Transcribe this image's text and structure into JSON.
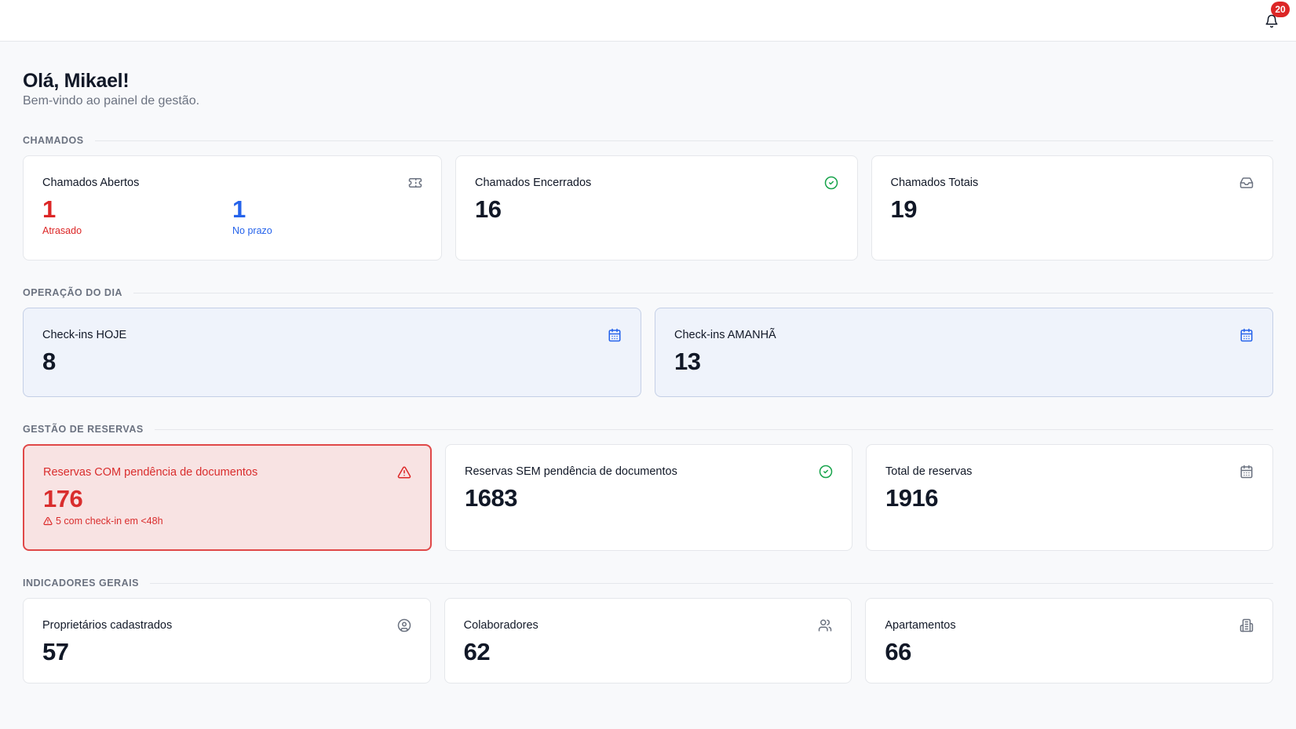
{
  "header": {
    "notifications_count": "20"
  },
  "greeting": {
    "title": "Olá, Mikael!",
    "subtitle": "Bem-vindo ao painel de gestão."
  },
  "sections": {
    "chamados": {
      "label": "CHAMADOS",
      "abertos": {
        "title": "Chamados Abertos",
        "atrasado_value": "1",
        "atrasado_label": "Atrasado",
        "prazo_value": "1",
        "prazo_label": "No prazo"
      },
      "encerrados": {
        "title": "Chamados Encerrados",
        "value": "16"
      },
      "totais": {
        "title": "Chamados Totais",
        "value": "19"
      }
    },
    "operacao": {
      "label": "OPERAÇÃO DO DIA",
      "hoje": {
        "title": "Check-ins HOJE",
        "value": "8"
      },
      "amanha": {
        "title": "Check-ins AMANHÃ",
        "value": "13"
      }
    },
    "reservas": {
      "label": "GESTÃO DE RESERVAS",
      "com": {
        "title": "Reservas COM pendência de documentos",
        "value": "176",
        "warning": "5 com check-in em <48h"
      },
      "sem": {
        "title": "Reservas SEM pendência de documentos",
        "value": "1683"
      },
      "total": {
        "title": "Total de reservas",
        "value": "1916"
      }
    },
    "indicadores": {
      "label": "INDICADORES GERAIS",
      "proprietarios": {
        "title": "Proprietários cadastrados",
        "value": "57"
      },
      "colaboradores": {
        "title": "Colaboradores",
        "value": "62"
      },
      "apartamentos": {
        "title": "Apartamentos",
        "value": "66"
      }
    }
  },
  "colors": {
    "danger": "#dc2626",
    "info": "#2563eb",
    "success": "#16a34a",
    "muted": "#6b7280"
  },
  "icons": [
    "bell-icon",
    "ticket-icon",
    "check-circle-icon",
    "inbox-icon",
    "calendar-icon",
    "alert-triangle-icon",
    "user-circle-icon",
    "users-icon",
    "building-icon"
  ]
}
